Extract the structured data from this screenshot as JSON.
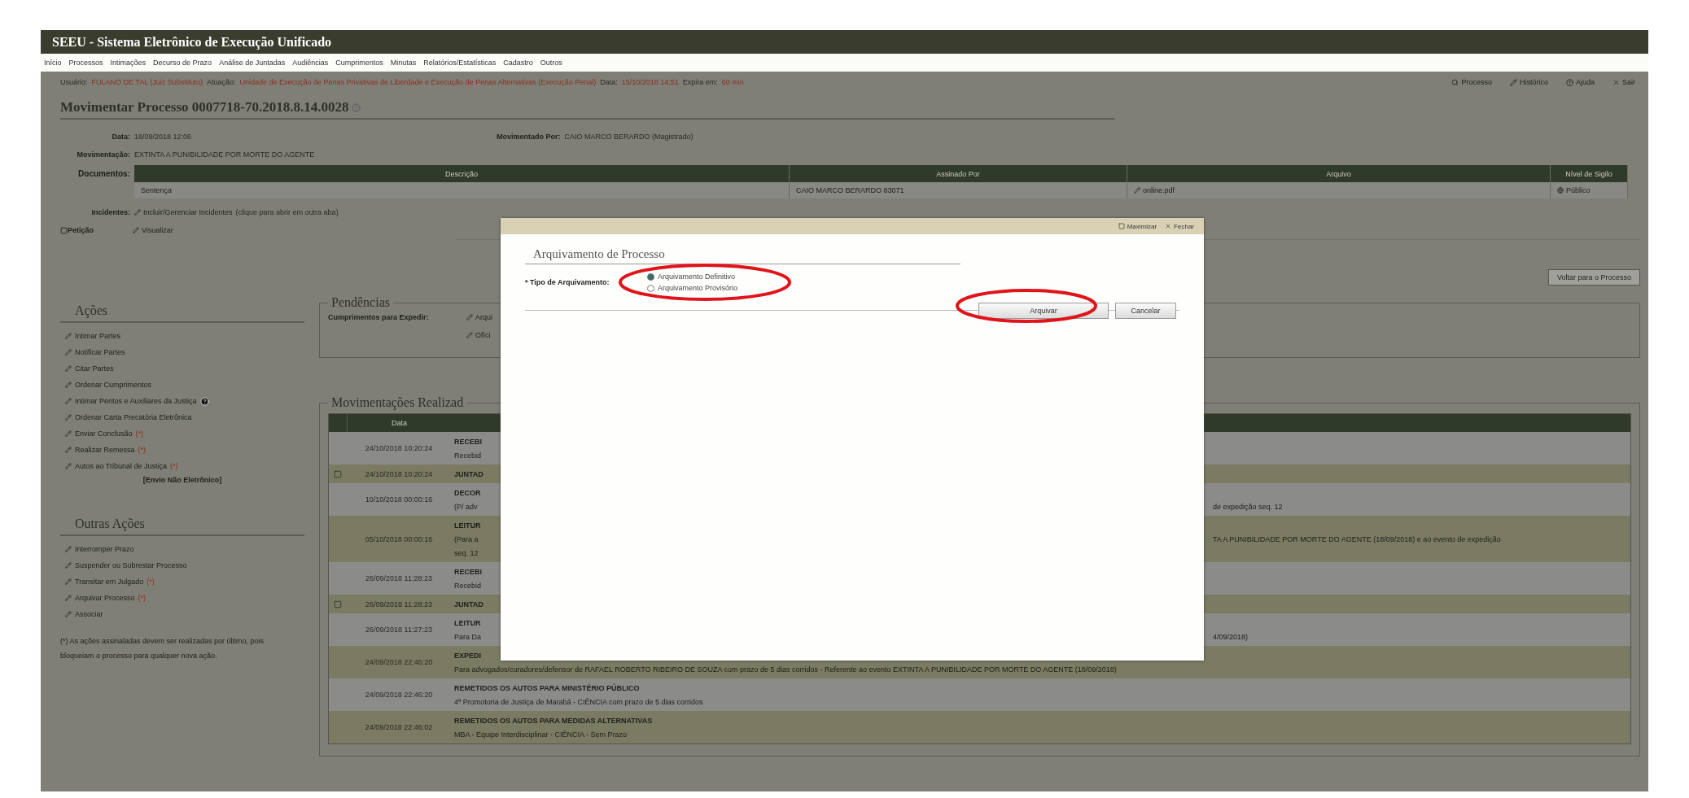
{
  "header": {
    "title": "SEEU - Sistema Eletrônico de Execução Unificado"
  },
  "menu": [
    "Início",
    "Processos",
    "Intimações",
    "Decurso de Prazo",
    "Análise de Juntadas",
    "Audiências",
    "Cumprimentos",
    "Minutas",
    "Relatórios/Estatísticas",
    "Cadastro",
    "Outros"
  ],
  "session": {
    "user_label": "Usuário:",
    "user": "FULANO DE TAL (Juiz Substituto)",
    "role_label": "Atuação:",
    "role": "Unidade de Execução de Penas Privativas de Liberdade e Execução de Penas Alternativas (Execução Penal)",
    "date_label": "Data:",
    "date": "15/10/2018 14:51",
    "expires_label": "Expira em:",
    "expires": "60 min"
  },
  "top_links": [
    "Processo",
    "Histórico",
    "Ajuda",
    "Sair"
  ],
  "process": {
    "title": "Movimentar Processo 0007718-70.2018.8.14.0028",
    "date_label": "Data:",
    "date": "18/09/2018 12:06",
    "by_label": "Movimentado Por:",
    "by": "CAIO MARCO BERARDO (Magistrado)",
    "movement_label": "Movimentação:",
    "movement": "EXTINTA A PUNIBILIDADE POR MORTE DO AGENTE"
  },
  "documents": {
    "label": "Documentos:",
    "columns": [
      "Descrição",
      "Assinado Por",
      "Arquivo",
      "Nível de Sigilo"
    ],
    "rows": [
      {
        "description": "Sentença",
        "signed_by": "CAIO MARCO BERARDO 83071",
        "file": "online.pdf",
        "secrecy": "Público"
      }
    ]
  },
  "incidents": {
    "label": "Incidentes:",
    "link": "Incluir/Gerenciar Incidentes",
    "hint": "(clique para abrir em outra aba)"
  },
  "petition": {
    "label": "Petição",
    "link": "Visualizar"
  },
  "back_button": "Voltar para o Processo",
  "actions": {
    "title": "Ações",
    "items": [
      {
        "label": "Intimar Partes",
        "help": false
      },
      {
        "label": "Notificar Partes",
        "help": false
      },
      {
        "label": "Citar Partes",
        "help": false
      },
      {
        "label": "Ordenar Cumprimentos",
        "help": false
      },
      {
        "label": "Intimar Peritos e Auxiliares da Justiça",
        "help": true
      },
      {
        "label": "Ordenar Carta Precatória Eletrônica",
        "help": false
      },
      {
        "label": "Enviar Conclusão",
        "note": "(*)",
        "help": false
      },
      {
        "label": "Realizar Remessa",
        "note": "(*)",
        "help": false
      },
      {
        "label": "Autos ao Tribunal de Justiça",
        "note": "(*)",
        "help": false
      }
    ],
    "footer": "[Envio Não Eletrônico]"
  },
  "other_actions": {
    "title": "Outras Ações",
    "items": [
      {
        "label": "Interromper Prazo"
      },
      {
        "label": "Suspender ou Sobrestar Processo"
      },
      {
        "label": "Transitar em Julgado",
        "note": "(*)"
      },
      {
        "label": "Arquivar Processo",
        "note": "(*)"
      },
      {
        "label": "Associar"
      }
    ],
    "footnote": "(*) As ações assinaladas devem ser realizadas por último, pois bloqueiam o processo para qualquer nova ação."
  },
  "pending": {
    "title": "Pendências",
    "label": "Cumprimentos para Expedir:",
    "links": [
      "Arqui",
      "Ofíci"
    ]
  },
  "movements": {
    "title": "Movimentações Realizad",
    "columns": [
      "Data"
    ],
    "rows": [
      {
        "kind": "event",
        "date": "24/10/2018 10:20:24",
        "lines": [
          {
            "left": "RECEBI"
          },
          {
            "left": "Recebid"
          }
        ]
      },
      {
        "kind": "juntada",
        "date": "24/10/2018 10:20:24",
        "lines": [
          {
            "left": "JUNTAD"
          }
        ]
      },
      {
        "kind": "event",
        "date": "10/10/2018 00:00:16",
        "lines": [
          {
            "left": "DECOR"
          },
          {
            "left": "(P/ adv",
            "right": "de expedição seq. 12"
          }
        ]
      },
      {
        "kind": "event",
        "date": "05/10/2018 00:00:16",
        "lines": [
          {
            "left": "LEITUR"
          },
          {
            "left": "(Para a",
            "right": "TA A PUNIBILIDADE POR MORTE DO AGENTE (18/09/2018) e ao evento de expedição"
          },
          {
            "left": "seq. 12"
          }
        ]
      },
      {
        "kind": "event",
        "date": "26/09/2018 11:28:23",
        "lines": [
          {
            "left": "RECEBI"
          },
          {
            "left": "Recebid"
          }
        ]
      },
      {
        "kind": "juntada",
        "date": "26/09/2018 11:28:23",
        "lines": [
          {
            "left": "JUNTAD"
          }
        ]
      },
      {
        "kind": "event",
        "date": "26/09/2018 11:27:23",
        "lines": [
          {
            "left": "LEITUR"
          },
          {
            "left": "Para Da",
            "right": "4/09/2018)"
          }
        ]
      },
      {
        "kind": "event",
        "date": "24/09/2018 22:46:20",
        "lines": [
          {
            "left": "EXPEDI"
          },
          {
            "full": "Para advogados/curadores/defensor de RAFAEL ROBERTO RIBEIRO DE SOUZA com prazo de 5 dias corridos - Referente ao evento EXTINTA A PUNIBILIDADE POR MORTE DO AGENTE (18/09/2018)"
          }
        ]
      },
      {
        "kind": "event",
        "date": "24/09/2018 22:46:20",
        "lines": [
          {
            "full": "REMETIDOS OS AUTOS PARA MINISTÉRIO PÚBLICO"
          },
          {
            "full": "4ª Promotoria de Justiça de Marabá - CIÊNCIA com prazo de 5 dias corridos"
          }
        ]
      },
      {
        "kind": "event",
        "date": "24/09/2018 22:46:02",
        "lines": [
          {
            "full": "REMETIDOS OS AUTOS PARA MEDIDAS ALTERNATIVAS"
          },
          {
            "full": "MBA - Equipe Interdisciplinar - CIÊNCIA - Sem Prazo"
          }
        ]
      }
    ]
  },
  "dialog": {
    "maximize": "Maximizar",
    "close": "Fechar",
    "title": "Arquivamento de Processo",
    "field_label": "* Tipo de Arquivamento:",
    "options": [
      {
        "label": "Arquivamento Definitivo",
        "selected": true
      },
      {
        "label": "Arquivamento Provisório",
        "selected": false
      }
    ],
    "buttons": [
      "Arquivar",
      "Cancelar"
    ]
  }
}
